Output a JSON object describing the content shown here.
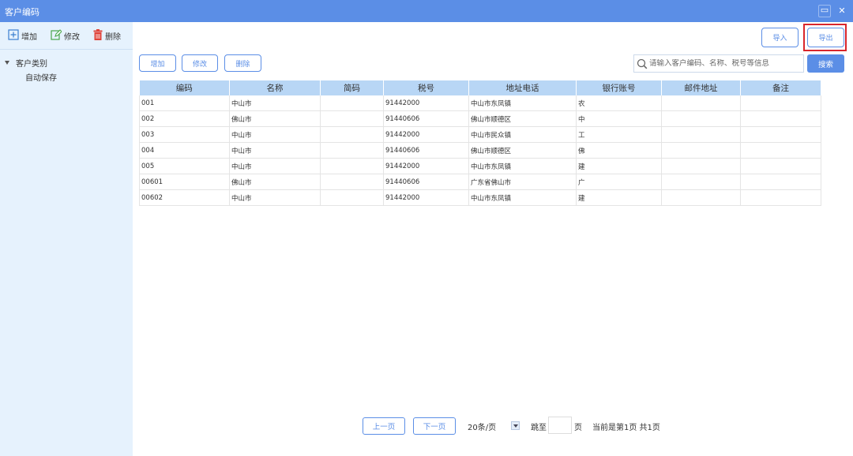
{
  "window": {
    "title": "客户编码",
    "minimize": "▭",
    "close": "✕"
  },
  "sidebar": {
    "toolbar": {
      "add": "增加",
      "edit": "修改",
      "delete": "删除"
    },
    "tree": {
      "root": "客户类别",
      "child": "自动保存"
    }
  },
  "toolbar": {
    "import": "导入",
    "export": "导出",
    "add": "增加",
    "edit": "修改",
    "delete": "删除"
  },
  "search": {
    "placeholder": "请输入客户编码、名称、税号等信息",
    "value": "",
    "button": "搜索"
  },
  "table": {
    "headers": [
      "编码",
      "名称",
      "简码",
      "税号",
      "地址电话",
      "银行账号",
      "邮件地址",
      "备注"
    ],
    "rows": [
      [
        "001",
        "中山市",
        "",
        "91442000",
        "中山市东凤镇",
        "农",
        "",
        ""
      ],
      [
        "002",
        "佛山市",
        "",
        "91440606",
        "佛山市顺德区",
        "中",
        "",
        ""
      ],
      [
        "003",
        "中山市",
        "",
        "91442000",
        "中山市民众镇",
        "工",
        "",
        ""
      ],
      [
        "004",
        "中山市",
        "",
        "91440606",
        "佛山市顺德区",
        "佛",
        "",
        ""
      ],
      [
        "005",
        "中山市",
        "",
        "91442000",
        "中山市东凤镇",
        "建",
        "",
        ""
      ],
      [
        "00601",
        "佛山市",
        "",
        "91440606",
        "广东省佛山市",
        "广",
        "",
        ""
      ],
      [
        "00602",
        "中山市",
        "",
        "91442000",
        "中山市东凤镇",
        "建",
        "",
        ""
      ]
    ]
  },
  "pager": {
    "prev": "上一页",
    "next": "下一页",
    "per_page": "20条/页",
    "jump_label": "跳至",
    "jump_value": "",
    "page_unit": "页",
    "status": "当前是第1页 共1页"
  },
  "colors": {
    "accent": "#5b8ee6",
    "header_bg": "#b8d6f5",
    "sidebar_bg": "#e6f2fd",
    "highlight": "#d9262c"
  }
}
